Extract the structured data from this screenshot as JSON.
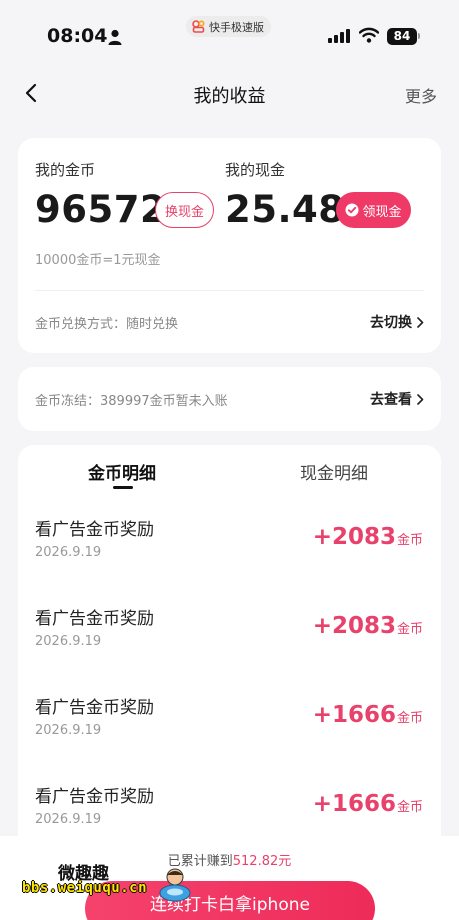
{
  "status_bar": {
    "time": "08:04",
    "app_name": "快手极速版",
    "battery": "84"
  },
  "nav": {
    "title": "我的收益",
    "more": "更多"
  },
  "balance": {
    "coin_label": "我的金币",
    "coin_value": "96572",
    "exchange_button": "换现金",
    "cash_label": "我的现金",
    "cash_value": "25.48",
    "withdraw_button": "领现金",
    "rate": "10000金币=1元现金",
    "method": "金币兑换方式：随时兑换",
    "switch_link": "去切换"
  },
  "freeze": {
    "text": "金币冻结：389997金币暂未入账",
    "link": "去查看"
  },
  "tabs": [
    "金币明细",
    "现金明细"
  ],
  "records": [
    {
      "title": "看广告金币奖励",
      "date": "2026.9.19",
      "amount": "+2083",
      "unit": "金币"
    },
    {
      "title": "看广告金币奖励",
      "date": "2026.9.19",
      "amount": "+2083",
      "unit": "金币"
    },
    {
      "title": "看广告金币奖励",
      "date": "2026.9.19",
      "amount": "+1666",
      "unit": "金币"
    },
    {
      "title": "看广告金币奖励",
      "date": "2026.9.19",
      "amount": "+1666",
      "unit": "金币"
    }
  ],
  "bottom": {
    "accum_prefix": "已累计赚到",
    "accum_amount": "512.82元",
    "cta": "连续打卡白拿iphone"
  },
  "watermark": {
    "text": "微趣趣",
    "url": "bbs.weiququ.cn"
  },
  "colors": {
    "accent": "#e8416b",
    "background": "#f5f5f7"
  }
}
